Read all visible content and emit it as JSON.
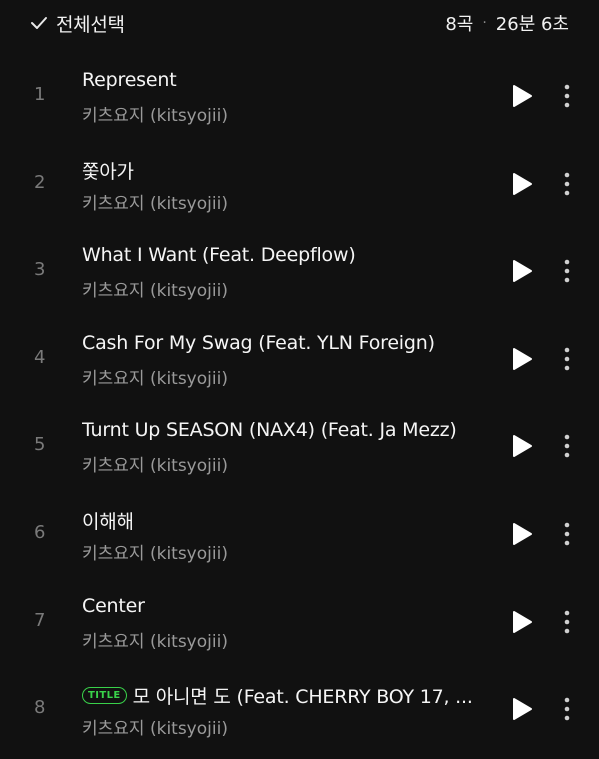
{
  "header": {
    "select_all_label": "전체선택",
    "track_count": "8곡",
    "separator": "·",
    "total_duration": "26분 6초"
  },
  "colors": {
    "background": "#111111",
    "title_badge": "#39d14a",
    "secondary_text": "#9a9a9a"
  },
  "tracks": [
    {
      "index": "1",
      "title": "Represent",
      "artist": "키츠요지 (kitsyojii)"
    },
    {
      "index": "2",
      "title": "쫓아가",
      "artist": "키츠요지 (kitsyojii)"
    },
    {
      "index": "3",
      "title": "What I Want (Feat. Deepflow)",
      "artist": "키츠요지 (kitsyojii)"
    },
    {
      "index": "4",
      "title": "Cash For My Swag (Feat. YLN Foreign)",
      "artist": "키츠요지 (kitsyojii)"
    },
    {
      "index": "5",
      "title": "Turnt Up SEASON (NAX4) (Feat. Ja Mezz)",
      "artist": "키츠요지 (kitsyojii)"
    },
    {
      "index": "6",
      "title": "이해해",
      "artist": "키츠요지 (kitsyojii)"
    },
    {
      "index": "7",
      "title": "Center",
      "artist": "키츠요지 (kitsyojii)"
    },
    {
      "index": "8",
      "badge": "TITLE",
      "title": "모 아니면 도 (Feat. CHERRY BOY 17, ...",
      "artist": "키츠요지 (kitsyojii)"
    }
  ],
  "icons": {
    "select_all": "check-icon",
    "play": "play-icon",
    "more": "more-vertical-icon"
  }
}
